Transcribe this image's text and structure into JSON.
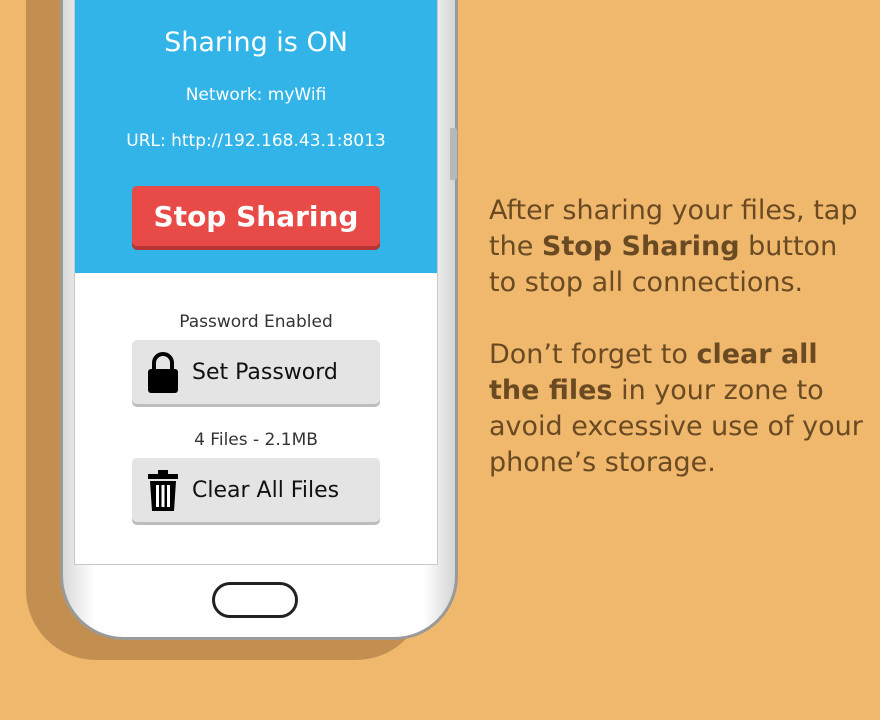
{
  "screen": {
    "status_title": "Sharing is ON",
    "network": "Network: myWifi",
    "url": "URL: http://192.168.43.1:8013",
    "stop_button": "Stop Sharing",
    "password_status": "Password Enabled",
    "set_password_button": "Set Password",
    "files_info": "4 Files - 2.1MB",
    "clear_files_button": "Clear All Files",
    "icons": {
      "set_password": "lock-icon",
      "clear_files": "trash-icon"
    }
  },
  "caption": {
    "para1_a": "After sharing your files, tap the ",
    "para1_bold": "Stop Sharing",
    "para1_b": " button to stop all connections.",
    "para2_a": "Don’t forget to ",
    "para2_bold": "clear all the files",
    "para2_b": " in your zone to avoid excessive use of your phone’s storage."
  },
  "colors": {
    "background": "#F0B86C",
    "header": "#33B4E9",
    "stop_button": "#E84A47",
    "caption_text": "#6A4A22"
  }
}
